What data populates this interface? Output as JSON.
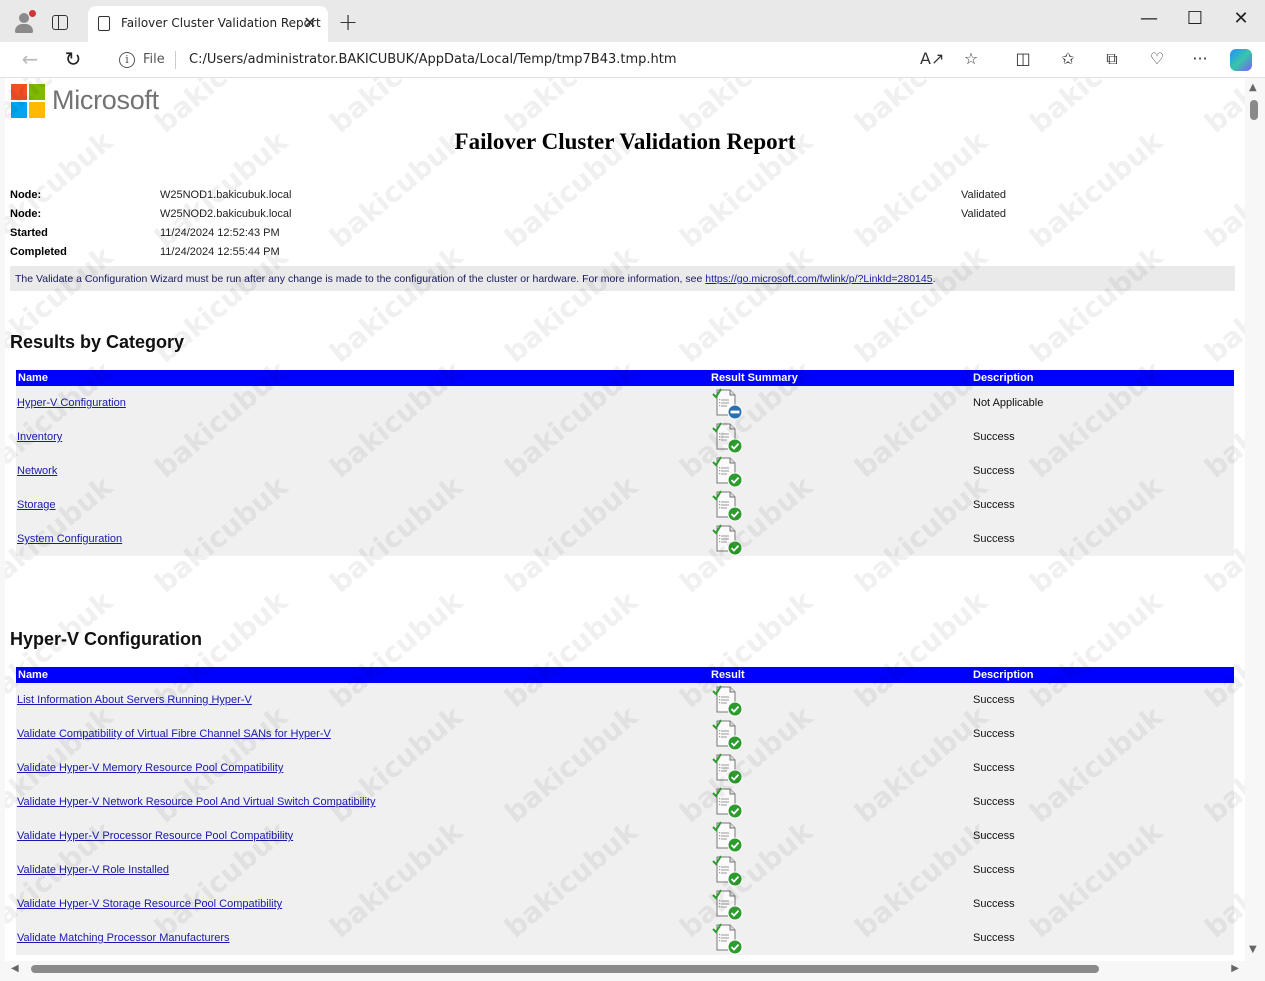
{
  "browser": {
    "tab_title": "Failover Cluster Validation Report",
    "file_label": "File",
    "url": "C:/Users/administrator.BAKICUBUK/AppData/Local/Temp/tmp7B43.tmp.htm"
  },
  "logo": {
    "text": "Microsoft"
  },
  "report": {
    "title": "Failover Cluster Validation Report",
    "meta": [
      {
        "label": "Node:",
        "value": "W25NOD1.bakicubuk.local",
        "status": "Validated"
      },
      {
        "label": "Node:",
        "value": "W25NOD2.bakicubuk.local",
        "status": "Validated"
      },
      {
        "label": "Started",
        "value": "11/24/2024 12:52:43 PM",
        "status": ""
      },
      {
        "label": "Completed",
        "value": "11/24/2024 12:55:44 PM",
        "status": ""
      }
    ],
    "notice_text": "The Validate a Configuration Wizard must be run after any change is made to the configuration of the cluster or hardware. For more information, see ",
    "notice_link": "https://go.microsoft.com/fwlink/p/?LinkId=280145",
    "notice_end": "."
  },
  "results_by_category": {
    "heading": "Results by Category",
    "columns": {
      "name": "Name",
      "result": "Result Summary",
      "description": "Description"
    },
    "rows": [
      {
        "name": "Hyper-V Configuration",
        "icon": "not-applicable-icon",
        "description": "Not Applicable"
      },
      {
        "name": "Inventory",
        "icon": "success-icon",
        "description": "Success"
      },
      {
        "name": "Network",
        "icon": "success-icon",
        "description": "Success"
      },
      {
        "name": "Storage",
        "icon": "success-icon",
        "description": "Success"
      },
      {
        "name": "System Configuration",
        "icon": "success-icon",
        "description": "Success"
      }
    ]
  },
  "hyperv_configuration": {
    "heading": "Hyper-V Configuration",
    "columns": {
      "name": "Name",
      "result": "Result",
      "description": "Description"
    },
    "rows": [
      {
        "name": "List Information About Servers Running Hyper-V",
        "icon": "success-icon",
        "description": "Success"
      },
      {
        "name": "Validate Compatibility of Virtual Fibre Channel SANs for Hyper-V",
        "icon": "success-icon",
        "description": "Success"
      },
      {
        "name": "Validate Hyper-V Memory Resource Pool Compatibility",
        "icon": "success-icon",
        "description": "Success"
      },
      {
        "name": "Validate Hyper-V Network Resource Pool And Virtual Switch Compatibility",
        "icon": "success-icon",
        "description": "Success"
      },
      {
        "name": "Validate Hyper-V Processor Resource Pool Compatibility",
        "icon": "success-icon",
        "description": "Success"
      },
      {
        "name": "Validate Hyper-V Role Installed",
        "icon": "success-icon",
        "description": "Success"
      },
      {
        "name": "Validate Hyper-V Storage Resource Pool Compatibility",
        "icon": "success-icon",
        "description": "Success"
      },
      {
        "name": "Validate Matching Processor Manufacturers",
        "icon": "success-icon",
        "description": "Success"
      }
    ]
  },
  "watermark": "bakicubuk",
  "colors": {
    "header_blue": "#0000ff",
    "link": "#1a1ab0",
    "success_green": "#2e9b2e",
    "na_blue": "#2a6fb0"
  }
}
